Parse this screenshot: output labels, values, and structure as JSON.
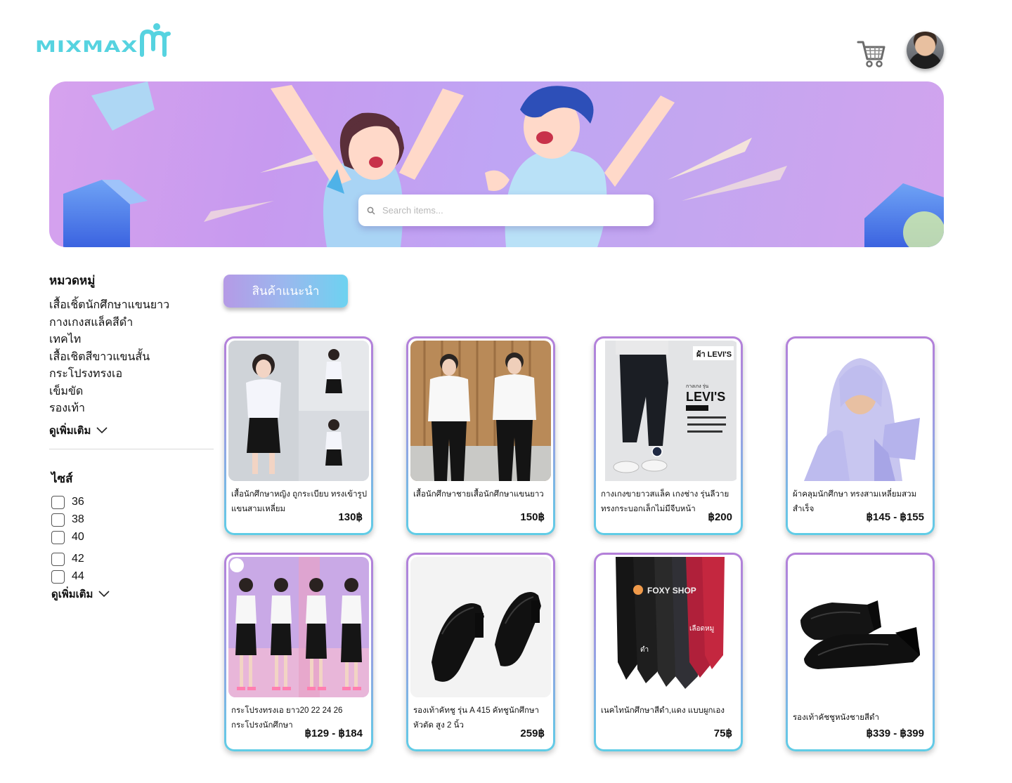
{
  "header": {
    "logo_text": "MIXMAX",
    "logo_mark": "M",
    "brand_color": "#56d3e0",
    "cart_icon": "cart-icon",
    "avatar_icon": "user-avatar"
  },
  "banner": {
    "search_placeholder": "Search items..."
  },
  "sidebar": {
    "category_title": "หมวดหมู่",
    "categories": [
      "เสื้อเชิ้ตนักศึกษาแขนยาว",
      "กางเกงสแล็คสีดำ",
      "เทคไท",
      "เสื้อเชิตสีขาวแขนสั้น",
      "กระโปรงทรงเอ",
      "เข็มขัด",
      "รองเท้า"
    ],
    "see_more": "ดูเพิ่มเติม",
    "size_title": "ไซส์",
    "sizes": [
      "36",
      "38",
      "40",
      "42",
      "44"
    ],
    "size_see_more": "ดูเพิ่มเติม"
  },
  "recommend_label": "สินค้าแนะนำ",
  "products": [
    {
      "name": "เสื้อนักศึกษาหญิง ถูกระเบียบ ทรงเข้ารูป แขนสามเหลี่ยม",
      "price": "130฿"
    },
    {
      "name": "เสื้อนักศึกษาชายเสื้อนักศึกษาแขนยาว",
      "price": "150฿"
    },
    {
      "name": "กางเกงขายาวสแล็ค เกงช่าง รุ่นลีวายทรงกระบอกเล็กไม่มีจีบหน้า",
      "price": "฿200",
      "image_text": {
        "tag": "ผ้า LEVI'S",
        "brand": "LEVI'S",
        "sub": "กางเกง รุ่น"
      }
    },
    {
      "name": "ผ้าคลุมนักศึกษา ทรงสามเหลี่ยมสวมสำเร็จ",
      "price": "฿145 - ฿155"
    },
    {
      "name": "กระโปรงทรงเอ ยาว20 22 24 26 กระโปรงนักศึกษา",
      "price": "฿129 - ฿184"
    },
    {
      "name": "รองเท้าคัทชู รุ่น A 415 คัทชูนักศึกษา หัวตัด สูง 2 นิ้ว",
      "price": "259฿"
    },
    {
      "name": "เนคไทนักศึกษาสีดำ,แดง แบบผูกเอง",
      "price": "75฿",
      "image_text": {
        "shop": "FOXY SHOP",
        "black": "ดำ",
        "red": "เลือดหมู"
      }
    },
    {
      "name": "รองเท้าคัชชูหนังชายสีดำ",
      "price": "฿339 - ฿399"
    }
  ]
}
